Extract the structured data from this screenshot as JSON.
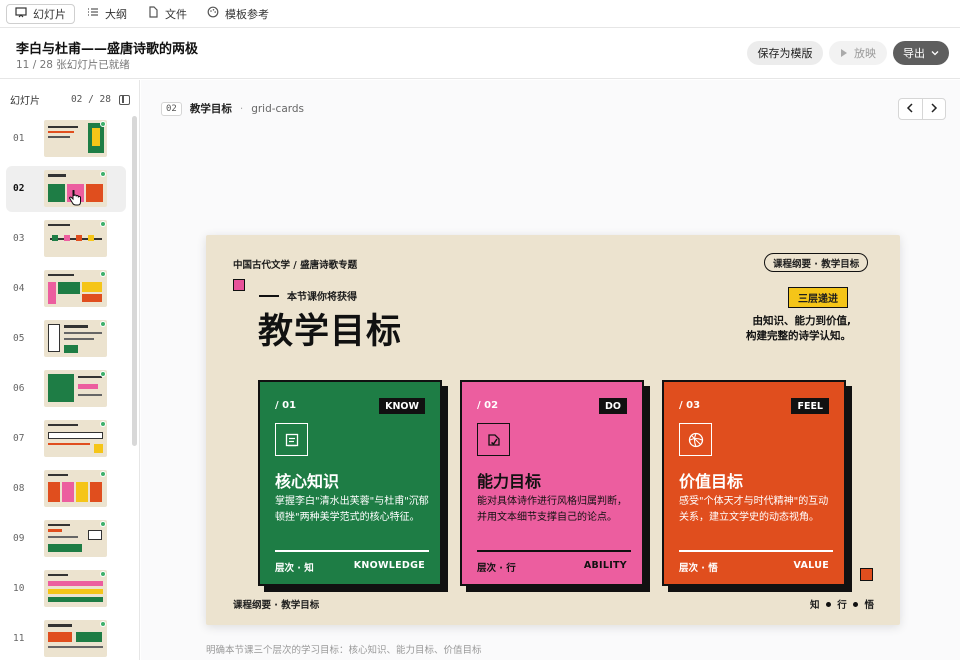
{
  "tabs": [
    {
      "icon": "slides-icon",
      "label": "幻灯片",
      "active": true
    },
    {
      "icon": "list-icon",
      "label": "大纲",
      "active": false
    },
    {
      "icon": "file-icon",
      "label": "文件",
      "active": false
    },
    {
      "icon": "palette-icon",
      "label": "模板参考",
      "active": false
    }
  ],
  "header": {
    "title": "李白与杜甫——盛唐诗歌的两极",
    "subtitle": "11 / 28 张幻灯片已就绪",
    "save_label": "保存为模版",
    "play_label": "放映",
    "export_label": "导出"
  },
  "sidebar": {
    "label": "幻灯片",
    "counter": "02 / 28",
    "slides": [
      {
        "num": "01",
        "selected": false
      },
      {
        "num": "02",
        "selected": true
      },
      {
        "num": "03",
        "selected": false
      },
      {
        "num": "04",
        "selected": false
      },
      {
        "num": "05",
        "selected": false
      },
      {
        "num": "06",
        "selected": false
      },
      {
        "num": "07",
        "selected": false
      },
      {
        "num": "08",
        "selected": false
      },
      {
        "num": "09",
        "selected": false
      },
      {
        "num": "10",
        "selected": false
      },
      {
        "num": "11",
        "selected": false
      }
    ]
  },
  "breadcrumb": {
    "num": "02",
    "name": "教学目标",
    "sep": "·",
    "layout": "grid-cards"
  },
  "slide": {
    "kicker": "中国古代文学 / 盛唐诗歌专题",
    "tag": "课程纲要 · 教学目标",
    "pre": "本节课你将获得",
    "heading": "教学目标",
    "badge": "三层递进",
    "note_line1": "由知识、能力到价值,",
    "note_line2": "构建完整的诗学认知。",
    "cards": [
      {
        "num": "/ 01",
        "badge": "KNOW",
        "title": "核心知识",
        "desc": "掌握李白\"清水出芙蓉\"与杜甫\"沉郁顿挫\"两种美学范式的核心特征。",
        "foot_left": "层次 · 知",
        "foot_right": "KNOWLEDGE",
        "color": "#1e7d45",
        "icon": "book-icon"
      },
      {
        "num": "/ 02",
        "badge": "DO",
        "title": "能力目标",
        "desc": "能对具体诗作进行风格归属判断，并用文本细节支撑自己的论点。",
        "foot_left": "层次 · 行",
        "foot_right": "ABILITY",
        "color": "#ec5e9f",
        "icon": "edit-icon"
      },
      {
        "num": "/ 03",
        "badge": "FEEL",
        "title": "价值目标",
        "desc": "感受\"个体天才与时代精神\"的互动关系，建立文学史的动态视角。",
        "foot_left": "层次 · 悟",
        "foot_right": "VALUE",
        "color": "#e04e1e",
        "icon": "compass-icon"
      }
    ],
    "footer_left": "课程纲要 · 教学目标",
    "footer_right": [
      "知",
      "行",
      "悟"
    ]
  },
  "caption": "明确本节课三个层次的学习目标：核心知识、能力目标、价值目标",
  "colors": {
    "green": "#1e7d45",
    "pink": "#ec5e9f",
    "orange": "#e04e1e",
    "yellow": "#f5c518",
    "paper": "#ece3cf"
  }
}
